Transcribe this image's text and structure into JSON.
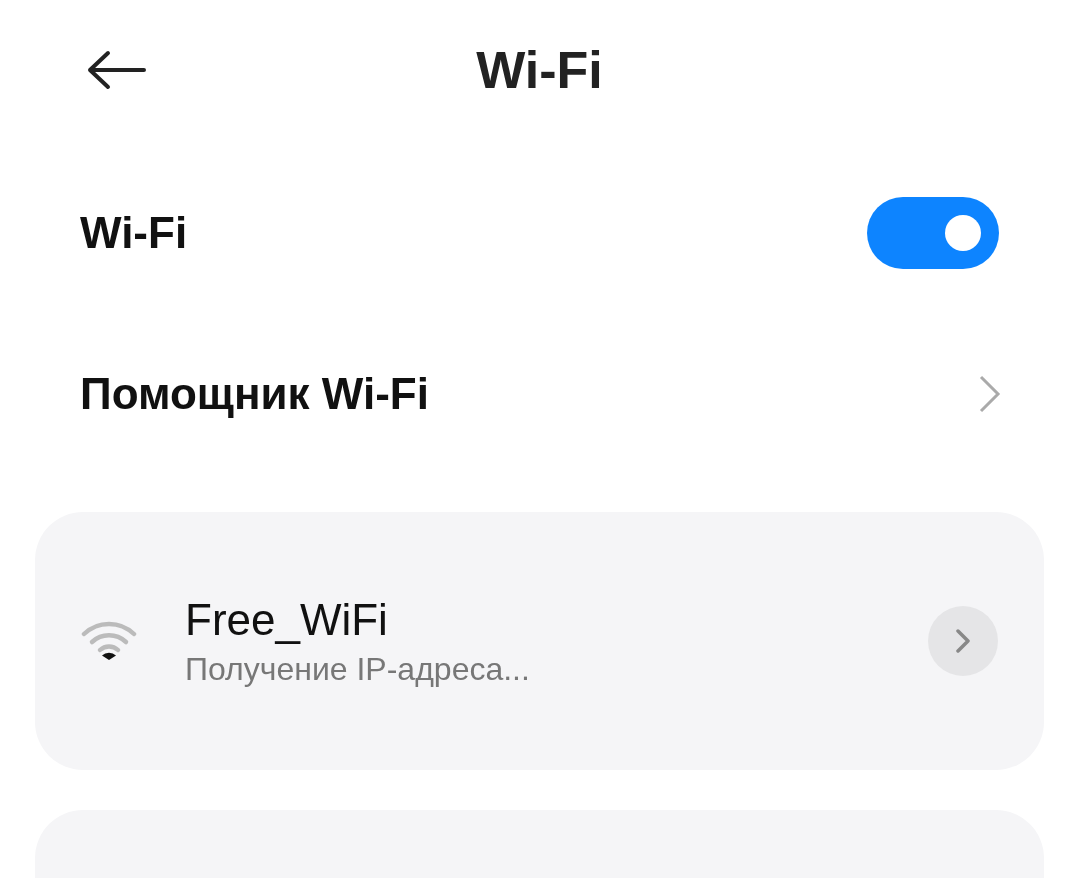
{
  "header": {
    "title": "Wi-Fi"
  },
  "wifi_toggle": {
    "label": "Wi-Fi",
    "on": true
  },
  "assistant": {
    "label": "Помощник Wi-Fi"
  },
  "networks": [
    {
      "name": "Free_WiFi",
      "status": "Получение IP-адреса..."
    }
  ]
}
